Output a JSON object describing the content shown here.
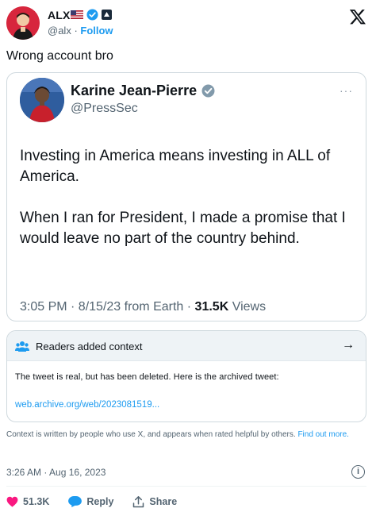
{
  "author": {
    "name": "ALX",
    "handle": "@alx",
    "separator": " · ",
    "follow_label": "Follow"
  },
  "tweet_text": "Wrong account bro",
  "quoted": {
    "name": "Karine Jean-Pierre",
    "handle": "@PressSec",
    "more_label": "···",
    "paragraph1": "Investing in America means investing in ALL of America.",
    "paragraph2": "When I ran for President, I made a promise that I would leave no part of the country behind.",
    "meta_prefix": "3:05 PM · 8/15/23 from Earth · ",
    "views_count": "31.5K",
    "views_label": " Views"
  },
  "community_note": {
    "title": "Readers added context",
    "arrow": "→",
    "text": "The tweet is real, but has been deleted. Here is the archived tweet:",
    "link": "web.archive.org/web/2023081519..."
  },
  "notes_footer": {
    "text": "Context is written by people who use X, and appears when rated helpful by others.",
    "link": "Find out more."
  },
  "timestamp": "3:26 AM · Aug 16, 2023",
  "info_symbol": "i",
  "actions": {
    "likes": "51.3K",
    "reply": "Reply",
    "share": "Share"
  },
  "colors": {
    "accent": "#1d9bf0",
    "like": "#f91880",
    "muted": "#536471"
  }
}
